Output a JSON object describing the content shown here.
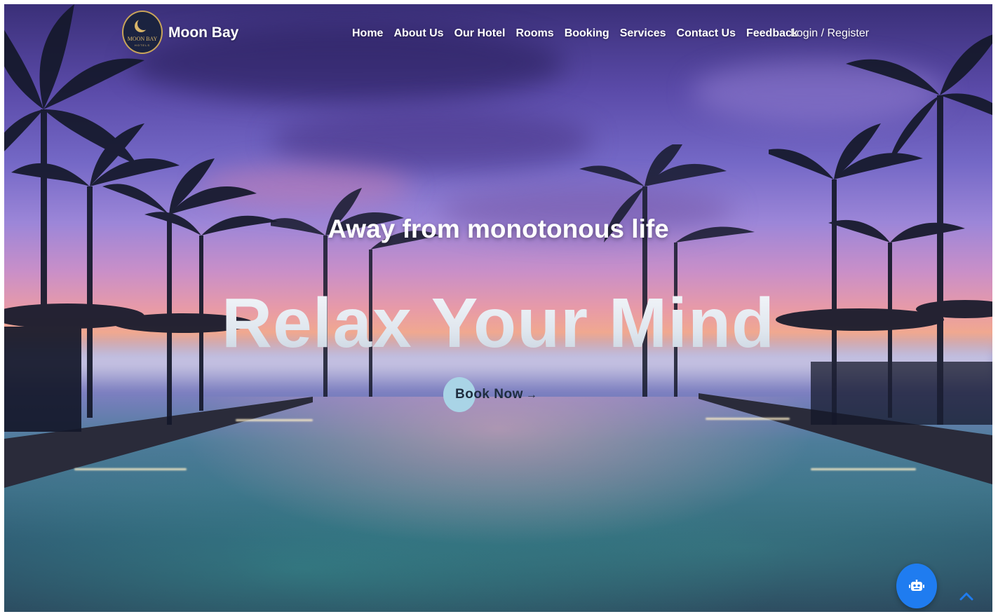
{
  "brand": {
    "logo_text": "MOON BAY",
    "logo_subtext": "HOTELS",
    "name": "Moon Bay"
  },
  "nav": {
    "items": [
      {
        "label": "Home"
      },
      {
        "label": "About Us"
      },
      {
        "label": "Our Hotel"
      },
      {
        "label": "Rooms"
      },
      {
        "label": "Booking"
      },
      {
        "label": "Services"
      },
      {
        "label": "Contact Us"
      },
      {
        "label": "Feedback"
      }
    ],
    "login_label": "Login / Register"
  },
  "hero": {
    "subtitle": "Away from monotonous life",
    "title": "Relax Your Mind",
    "cta_label": "Book Now",
    "cta_arrow": "→"
  },
  "floating": {
    "chatbot_icon": "robot-icon",
    "scroll_top_icon": "chevron-up-icon",
    "chatbot_color": "#1f7cf0",
    "scroll_top_color": "#1f7cf0"
  },
  "colors": {
    "cta_accent": "#a9d4e6",
    "logo_gold": "#d8b56a",
    "logo_navy": "#1b2340"
  }
}
